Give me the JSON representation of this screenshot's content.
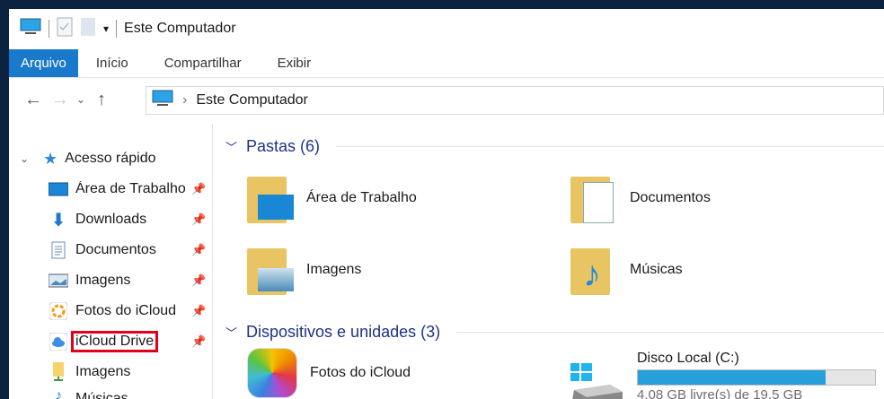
{
  "window": {
    "title": "Este Computador"
  },
  "ribbon": {
    "tabs": [
      "Arquivo",
      "Início",
      "Compartilhar",
      "Exibir"
    ]
  },
  "address": {
    "path": "Este Computador"
  },
  "sidebar": {
    "quick_access": "Acesso rápido",
    "items": [
      {
        "label": "Área de Trabalho",
        "pinned": true
      },
      {
        "label": "Downloads",
        "pinned": true
      },
      {
        "label": "Documentos",
        "pinned": true
      },
      {
        "label": "Imagens",
        "pinned": true
      },
      {
        "label": "Fotos do iCloud",
        "pinned": true
      },
      {
        "label": "iCloud Drive",
        "pinned": true
      },
      {
        "label": "Imagens",
        "pinned": false
      },
      {
        "label": "Músicas",
        "pinned": false
      }
    ]
  },
  "folders": {
    "header": "Pastas (6)",
    "items": [
      "Área de Trabalho",
      "Documentos",
      "Imagens",
      "Músicas"
    ]
  },
  "devices": {
    "header": "Dispositivos e unidades (3)",
    "icloud": "Fotos do iCloud",
    "disk": {
      "name": "Disco Local (C:)",
      "free": "4,08 GB livre(s) de 19,5 GB",
      "used_percent": 79
    }
  },
  "colors": {
    "accent": "#1979ca",
    "highlight": "#e0001b",
    "bar": "#26a0da"
  }
}
